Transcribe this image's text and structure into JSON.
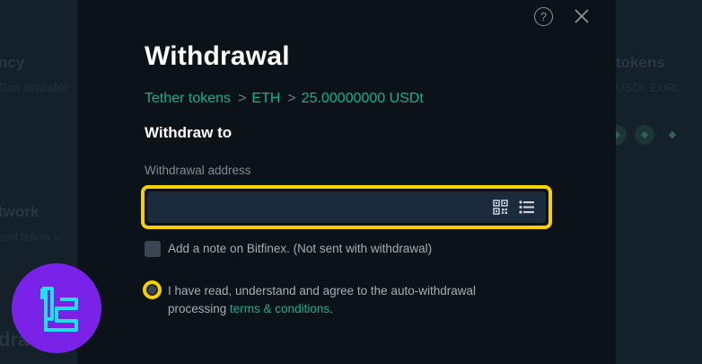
{
  "background": {
    "left_heading_1": "ncy",
    "left_sub_1": "Gas  available",
    "left_heading_2": "twork",
    "left_sub_2": "and follow w",
    "left_heading_3": "dra",
    "right_heading": "tokens",
    "right_sub": "USDt, EURt, ..."
  },
  "modal": {
    "help_glyph": "?",
    "title": "Withdrawal",
    "breadcrumb": [
      "Tether tokens",
      "ETH",
      "25.00000000 USDt"
    ],
    "breadcrumb_separator": ">",
    "subtitle": "Withdraw to",
    "address": {
      "label": "Withdrawal address",
      "value": "",
      "placeholder": ""
    },
    "note_checkbox_label": "Add a note on Bitfinex. (Not sent with withdrawal)",
    "agree_text": "I have read, understand and agree to the auto-withdrawal processing ",
    "terms_link": "terms & conditions",
    "agree_end": "."
  },
  "colors": {
    "accent_green": "#17b08f",
    "highlight_yellow": "#f6d000",
    "logo_purple": "#7b22e8",
    "logo_cyan": "#22e0ea"
  },
  "icons": [
    "help-icon",
    "close-icon",
    "qr-code-icon",
    "address-list-icon",
    "logo"
  ]
}
